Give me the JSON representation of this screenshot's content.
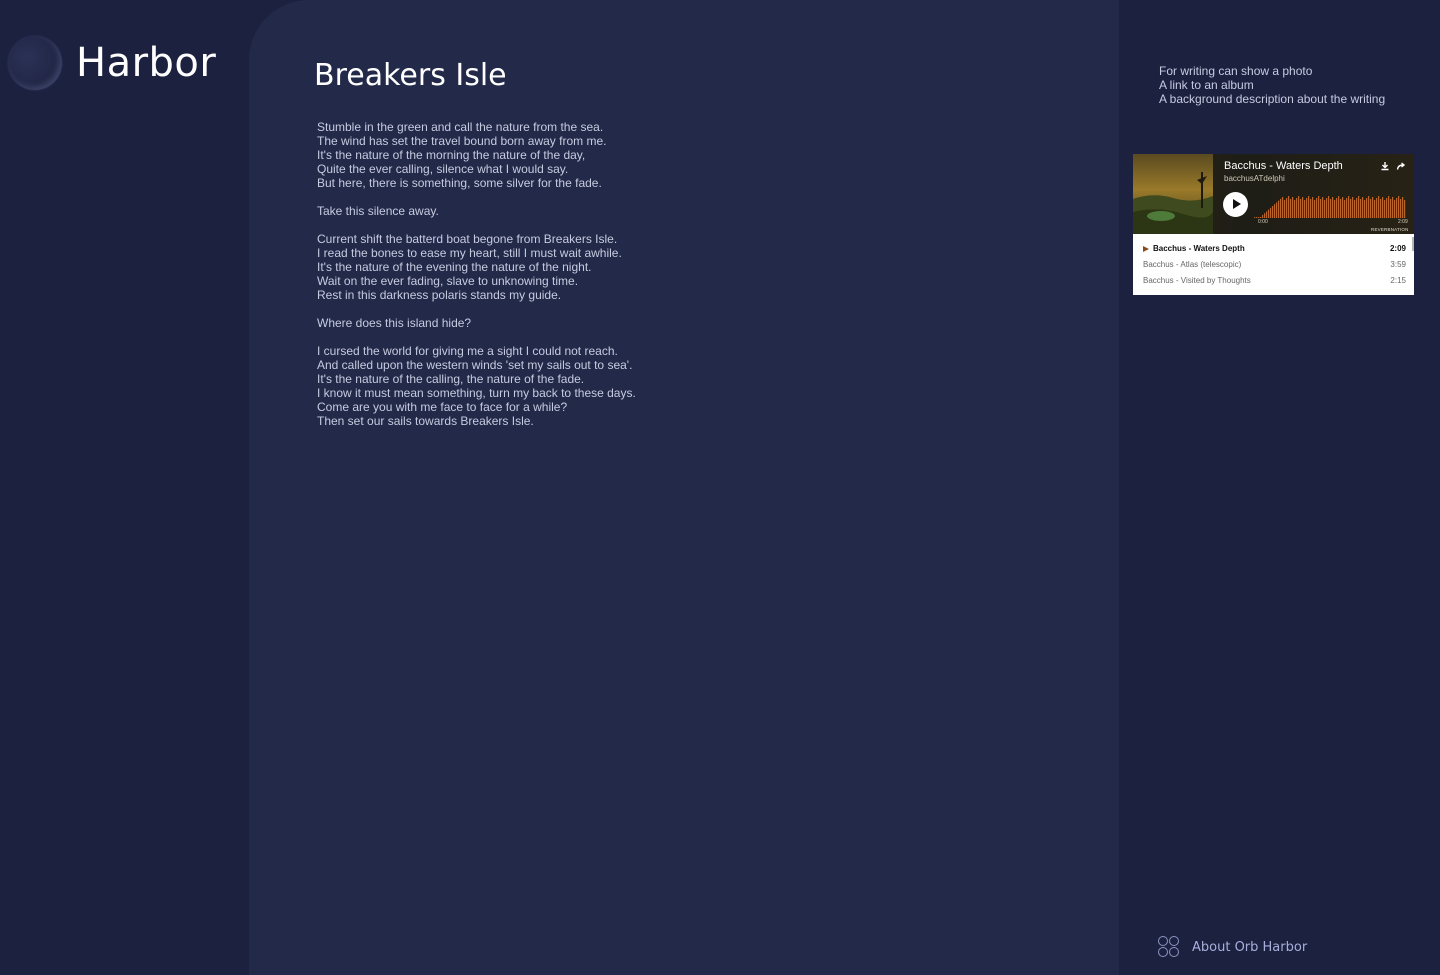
{
  "brand": {
    "name": "Harbor"
  },
  "article": {
    "title": "Breakers Isle",
    "stanzas": [
      [
        "Stumble in the green and call the nature from the sea.",
        "The wind has set the travel bound born away from me.",
        "It's the nature of the morning the nature of the day,",
        "Quite the ever calling, silence what I would say.",
        "But here, there is something, some silver for the fade."
      ],
      [
        "Take this silence away."
      ],
      [
        "Current shift the batterd boat begone from Breakers Isle.",
        "I read the bones to ease my heart, still I must wait awhile.",
        "It's the nature of the evening the nature of the night.",
        "Wait on the ever fading, slave to unknowing time.",
        "Rest in this darkness polaris stands my guide."
      ],
      [
        "Where does this island hide?"
      ],
      [
        "I cursed the world for giving me a sight I could not reach.",
        "And called upon the western winds 'set my sails out to sea'.",
        "It's the nature of the calling, the nature of the fade.",
        "I know it must mean something, turn my back to these days.",
        "Come are you with me face to face for a while?",
        "Then set our sails towards Breakers Isle."
      ]
    ]
  },
  "sidebar": {
    "info_lines": [
      "For writing can show a photo",
      "A link to an album",
      "A background description about the writing"
    ],
    "player": {
      "track_title": "Bacchus - Waters Depth",
      "artist": "bacchusATdelphi",
      "time_start": "0:00",
      "time_end": "2:09",
      "brand_mark": "REVERBNATION",
      "download_icon": "download-icon",
      "share_icon": "share-icon",
      "tracks": [
        {
          "name": "Bacchus - Waters Depth",
          "duration": "2:09"
        },
        {
          "name": "Bacchus - Atlas (telescopic)",
          "duration": "3:59"
        },
        {
          "name": "Bacchus - Visited by Thoughts",
          "duration": "2:15"
        }
      ]
    },
    "about_label": "About Orb Harbor"
  }
}
